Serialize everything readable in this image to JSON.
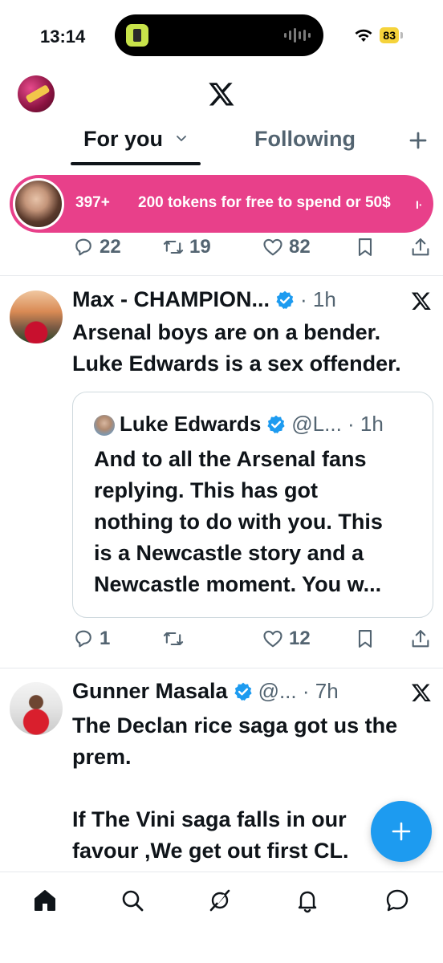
{
  "status_bar": {
    "time": "13:14",
    "battery": "83"
  },
  "header": {
    "logo": "x-logo-icon"
  },
  "tabs": {
    "for_you": "For you",
    "following": "Following"
  },
  "promo": {
    "count": "397+",
    "text": "200 tokens for free to spend or 50$",
    "trail": "I·"
  },
  "prev_actions": {
    "replies": "22",
    "reposts": "19",
    "likes": "82"
  },
  "tweets": [
    {
      "name": "Max - CHAMPION...",
      "meta": "· 1h",
      "body_lines": [
        "Arsenal boys are on a bender.",
        "Luke Edwards is a sex offender."
      ],
      "quote": {
        "name": "Luke Edwards",
        "meta": "@L... · 1h",
        "body_lines": [
          "And to all the Arsenal fans",
          "replying. This has got",
          "nothing to do with you. This",
          "is a Newcastle story and a",
          "Newcastle moment. You w..."
        ]
      },
      "actions": {
        "replies": "1",
        "reposts": "",
        "likes": "12"
      }
    },
    {
      "name": "Gunner Masala",
      "meta": "@... · 7h",
      "body_lines": [
        "The Declan rice saga got us the",
        "prem.",
        "",
        "If The Vini saga falls in our",
        "favour ,We get out first CL."
      ]
    }
  ],
  "colors": {
    "accent": "#1d9bf0",
    "promo": "#e8408a",
    "muted": "#536471"
  }
}
